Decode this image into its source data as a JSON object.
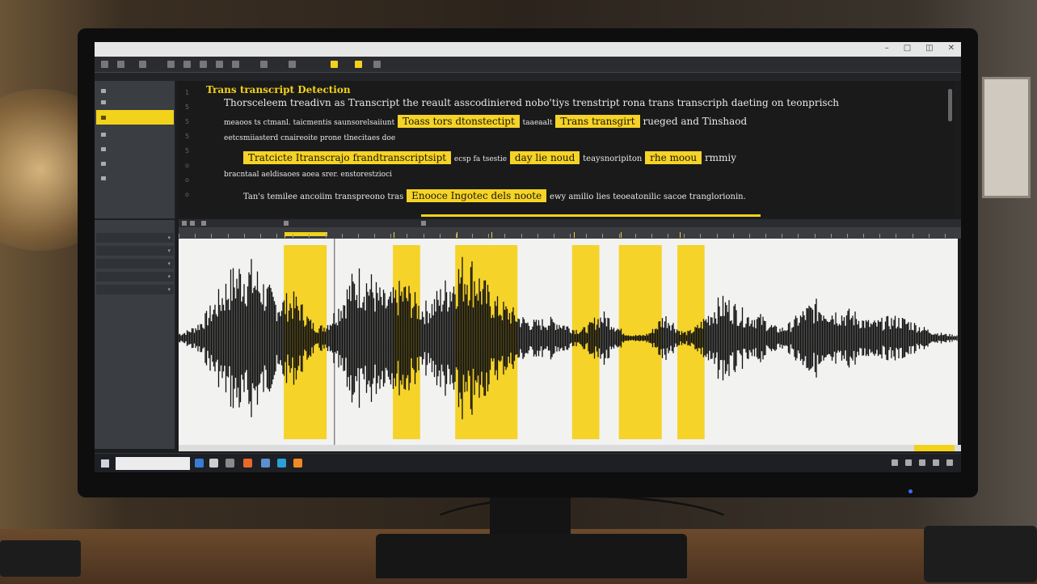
{
  "window": {
    "title": "",
    "toolbar_title": "",
    "sub_title": ""
  },
  "sidebar": {
    "items": [
      {
        "label": ""
      },
      {
        "label": ""
      },
      {
        "label": ""
      },
      {
        "label": ""
      },
      {
        "label": ""
      },
      {
        "label": ""
      },
      {
        "label": ""
      }
    ],
    "active_index": 2,
    "rows": [
      {
        "label": ""
      },
      {
        "label": ""
      },
      {
        "label": ""
      },
      {
        "label": ""
      },
      {
        "label": ""
      }
    ],
    "status": ""
  },
  "transcript": {
    "heading": "Trans transcript Detection",
    "lines": [
      {
        "before": "Thorsceleem treadivn as Transcript the reault asscodiniered nobo'tiys trenstript rona trans transcriph daeting on teonprisch",
        "highlight": "",
        "after": ""
      },
      {
        "before": "meaoos ts ctmanl. taicmentis saunsorelsaiiunt",
        "highlight": "Toass tors dtonstectipt",
        "after": "taaeaalt",
        "highlight2": "Trans transgirt",
        "after2": "rueged and Tinshaod"
      },
      {
        "before": "eetcsmiiasterd cnaireoite prone tlnecitaes doe",
        "highlight": "",
        "after": ""
      },
      {
        "before": "",
        "highlight": "Tratcicte Itranscrajo frandtranscriptsipt",
        "after": "ecsp fa tsestie",
        "highlight2": "day lie noud",
        "after2": "teaysnoripiton",
        "highlight3": "rhe moou",
        "after3": "rmmiy"
      },
      {
        "before": "bracntaal aeldisaoes aoea srer. enstorestzioci",
        "highlight": "",
        "after": ""
      },
      {
        "before": "Tan's temilee ancoiim transpreono tras",
        "highlight": "Enooce Ingotec dels noote",
        "after": "ewy amilio lies teoeatonilic sacoe tranglorionin."
      }
    ]
  },
  "waveform": {
    "highlight_regions": [
      {
        "start": 0.135,
        "end": 0.19
      },
      {
        "start": 0.275,
        "end": 0.31
      },
      {
        "start": 0.355,
        "end": 0.4
      },
      {
        "start": 0.4,
        "end": 0.435
      },
      {
        "start": 0.505,
        "end": 0.54
      },
      {
        "start": 0.565,
        "end": 0.62
      },
      {
        "start": 0.64,
        "end": 0.675
      }
    ],
    "playhead": 0.2,
    "accent_color": "#f5d328",
    "wave_color": "#111111"
  },
  "taskbar": {
    "search_placeholder": "",
    "clock": ""
  }
}
